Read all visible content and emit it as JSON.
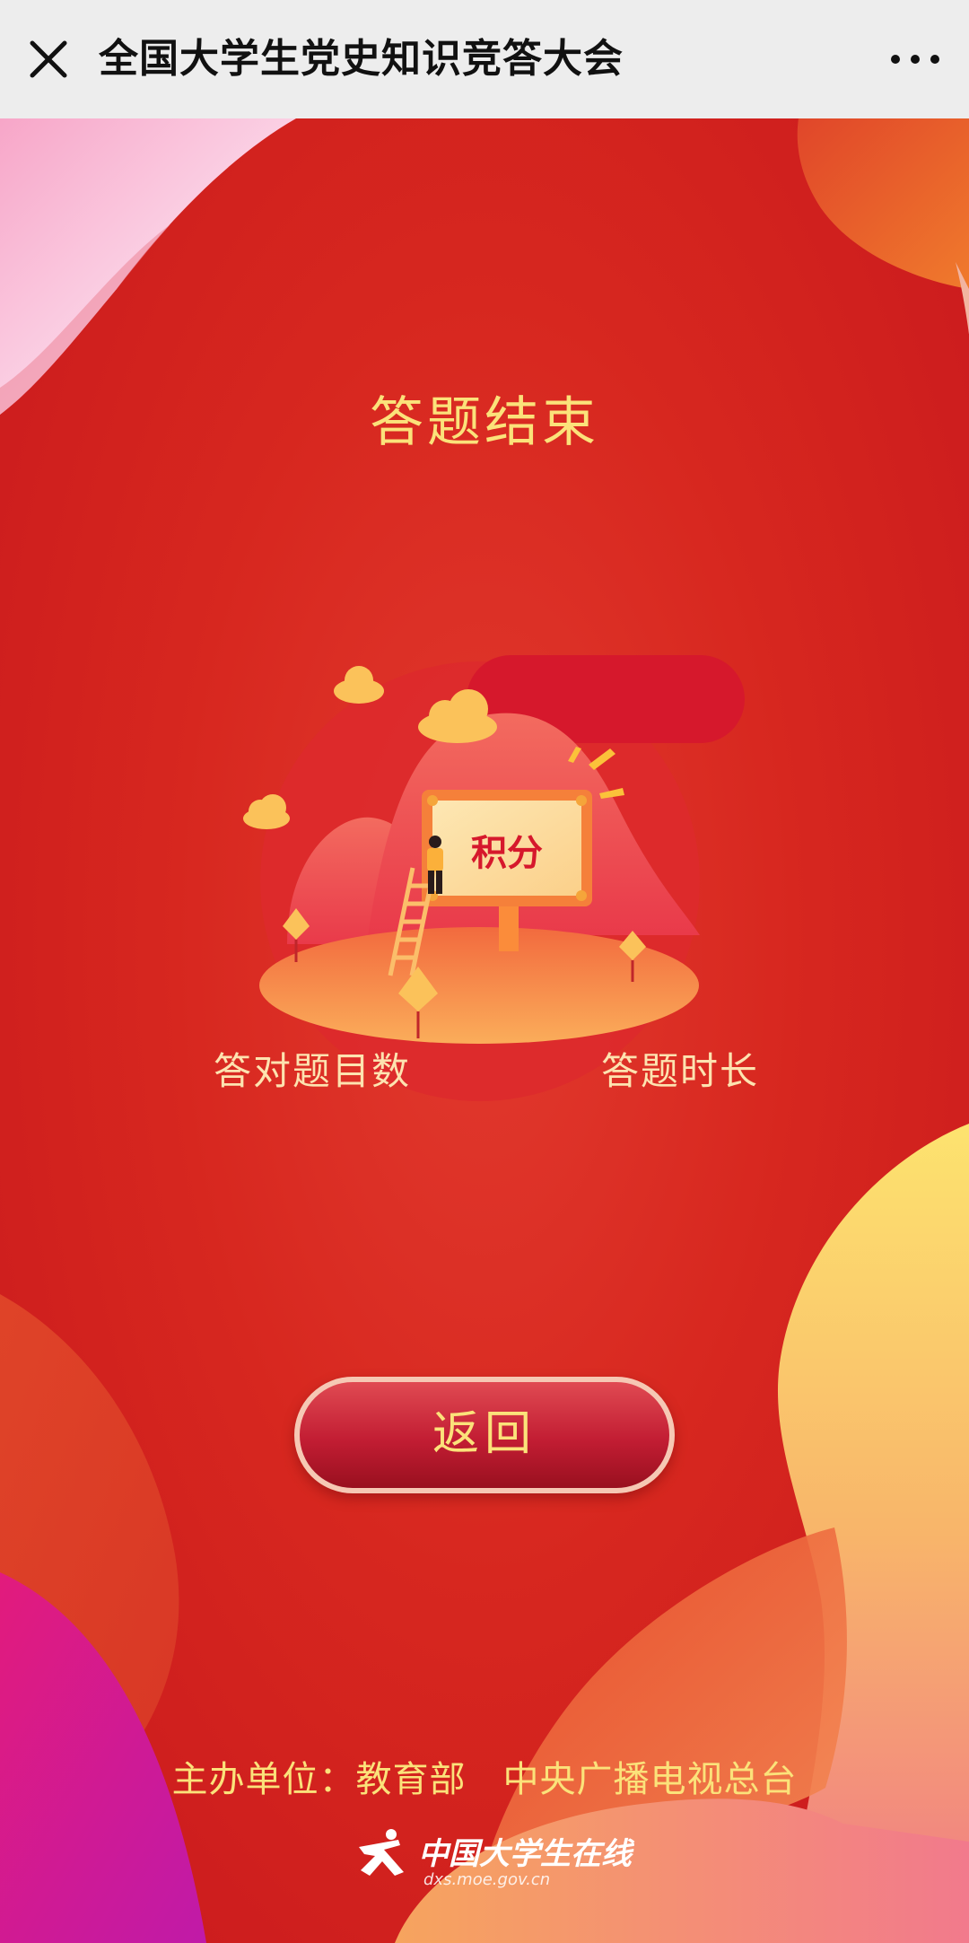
{
  "header": {
    "title": "全国大学生党史知识竞答大会",
    "close_icon": "close-icon",
    "more_icon": "more-dots-icon"
  },
  "result": {
    "title": "答题结束",
    "badge_text": "积分",
    "correct_label": "答对题目数",
    "time_label": "答题时长"
  },
  "actions": {
    "back_label": "返回"
  },
  "footer": {
    "sponsor": "主办单位：教育部　中央广播电视总台",
    "logo_text": "中国大学生在线",
    "logo_url": "dxs.moe.gov.cn"
  },
  "colors": {
    "accent_gold": "#fbe27a",
    "primary_red": "#d42a24",
    "header_bg": "#ededed"
  }
}
